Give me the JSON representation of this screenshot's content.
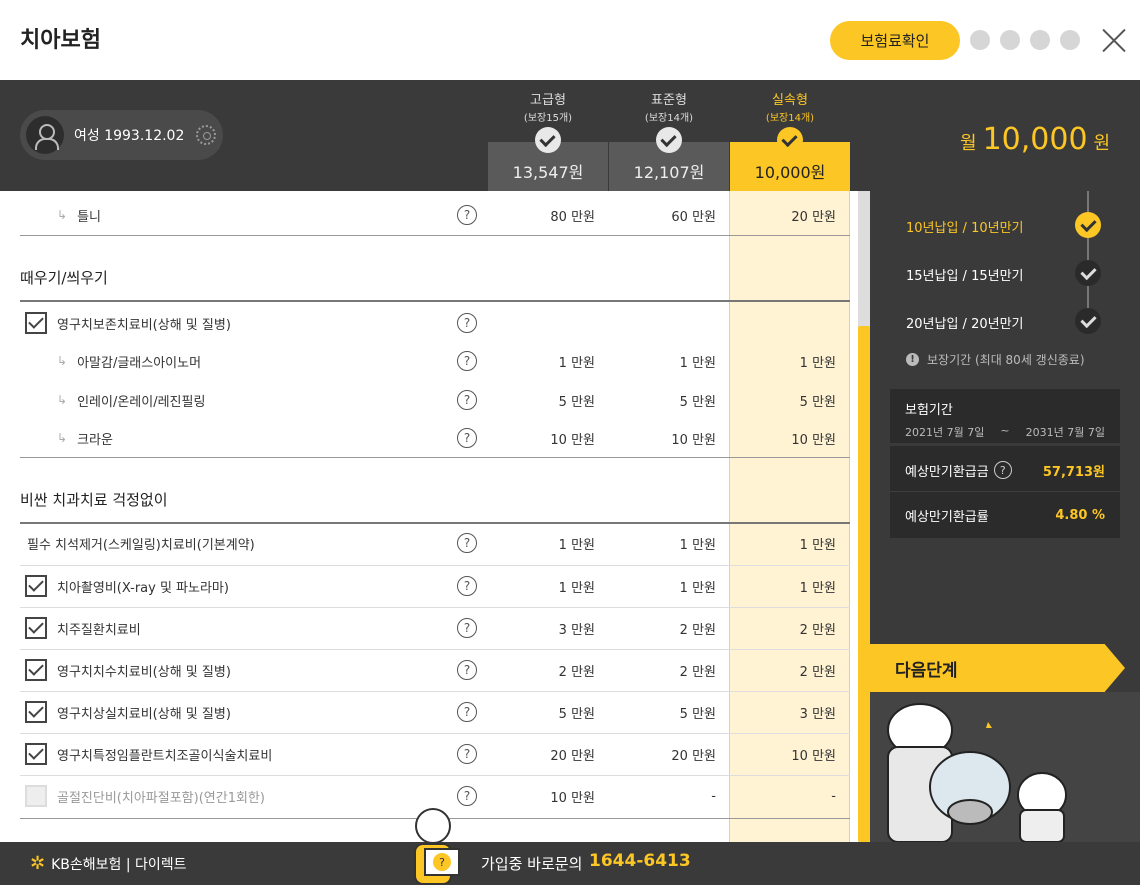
{
  "header": {
    "title": "치아보험",
    "check_button": "보험료확인"
  },
  "user": {
    "info": "여성 1993.12.02"
  },
  "plans": [
    {
      "name": "고급형",
      "sub": "(보장15개)",
      "price": "13,547원",
      "active": false
    },
    {
      "name": "표준형",
      "sub": "(보장14개)",
      "price": "12,107원",
      "active": false
    },
    {
      "name": "실속형",
      "sub": "(보장14개)",
      "price": "10,000원",
      "active": true
    }
  ],
  "total": {
    "prefix": "월",
    "amount": "10,000",
    "suffix": "원"
  },
  "table": {
    "help_glyph": "?",
    "sub_arrow": "↳",
    "rows": [
      {
        "kind": "sub",
        "label": "틀니",
        "v1": "80 만원",
        "v2": "60 만원",
        "v3": "20 만원"
      },
      {
        "kind": "section",
        "label": "때우기/씌우기"
      },
      {
        "kind": "check",
        "label": "영구치보존치료비(상해 및 질병)",
        "checked": true,
        "v1": "",
        "v2": "",
        "v3": ""
      },
      {
        "kind": "sub",
        "label": "아말감/글래스아이노머",
        "v1": "1 만원",
        "v2": "1 만원",
        "v3": "1 만원"
      },
      {
        "kind": "sub",
        "label": "인레이/온레이/레진필링",
        "v1": "5 만원",
        "v2": "5 만원",
        "v3": "5 만원"
      },
      {
        "kind": "sub",
        "label": "크라운",
        "v1": "10 만원",
        "v2": "10 만원",
        "v3": "10 만원"
      },
      {
        "kind": "section",
        "label": "비싼 치과치료 걱정없이"
      },
      {
        "kind": "plain",
        "label": "필수 치석제거(스케일링)치료비(기본계약)",
        "v1": "1 만원",
        "v2": "1 만원",
        "v3": "1 만원"
      },
      {
        "kind": "check",
        "label": "치아촬영비(X-ray 및 파노라마)",
        "checked": true,
        "v1": "1 만원",
        "v2": "1 만원",
        "v3": "1 만원"
      },
      {
        "kind": "check",
        "label": "치주질환치료비",
        "checked": true,
        "v1": "3 만원",
        "v2": "2 만원",
        "v3": "2 만원"
      },
      {
        "kind": "check",
        "label": "영구치치수치료비(상해 및 질병)",
        "checked": true,
        "v1": "2 만원",
        "v2": "2 만원",
        "v3": "2 만원"
      },
      {
        "kind": "check",
        "label": "영구치상실치료비(상해 및 질병)",
        "checked": true,
        "v1": "5 만원",
        "v2": "5 만원",
        "v3": "3 만원"
      },
      {
        "kind": "check",
        "label": "영구치특정임플란트치조골이식술치료비",
        "checked": true,
        "v1": "20 만원",
        "v2": "20 만원",
        "v3": "10 만원"
      },
      {
        "kind": "check",
        "label": "골절진단비(치아파절포함)(연간1회한)",
        "checked": false,
        "disabled": true,
        "v1": "10 만원",
        "v2": "-",
        "v3": "-"
      }
    ]
  },
  "sidebar": {
    "terms": [
      {
        "label": "10년납입 / 10년만기",
        "active": true
      },
      {
        "label": "15년납입 / 15년만기",
        "active": false
      },
      {
        "label": "20년납입 / 20년만기",
        "active": false
      }
    ],
    "notice_glyph": "!",
    "notice": "보장기간 (최대 80세 갱신종료)",
    "period_label": "보험기간",
    "period_start": "2021년 7월 7일",
    "period_sep": "~",
    "period_end": "2031년 7월 7일",
    "refund_label": "예상만기환급금",
    "refund_value": "57,713원",
    "rate_label": "예상만기환급률",
    "rate_value": "4.80 %",
    "next_button": "다음단계"
  },
  "footer": {
    "logo_star": "✲",
    "logo": "KB손해보험 | 다이렉트",
    "call_label": "가입중 바로문의",
    "call_number": "1644-6413"
  },
  "colors": {
    "accent": "#fcc625",
    "dark": "#3a3a3a"
  }
}
